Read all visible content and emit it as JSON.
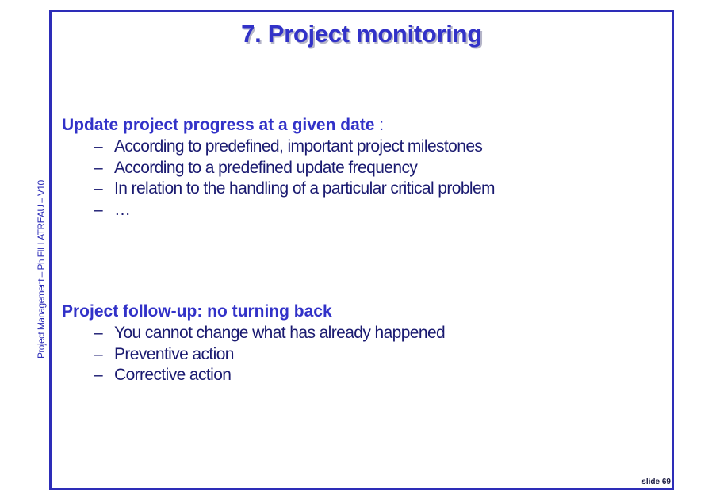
{
  "slide": {
    "title": "7. Project monitoring",
    "side_footer": "Project Management – Ph FILLATREAU – V10",
    "slide_number": "slide 69"
  },
  "section1": {
    "heading": "Update project progress at a given date",
    "heading_suffix": " :",
    "bullets": [
      "According to predefined, important project milestones",
      "According to a predefined update frequency",
      "In relation to the handling of a particular critical problem",
      "…"
    ]
  },
  "section2": {
    "heading": "Project follow-up: no turning back",
    "bullets": [
      "You cannot change what has already happened",
      "Preventive action",
      "Corrective action"
    ]
  },
  "bullet_dash": "–",
  "colors": {
    "accent": "#3232c8",
    "body_text": "#1a1a70",
    "frame": "#2d2db8"
  }
}
